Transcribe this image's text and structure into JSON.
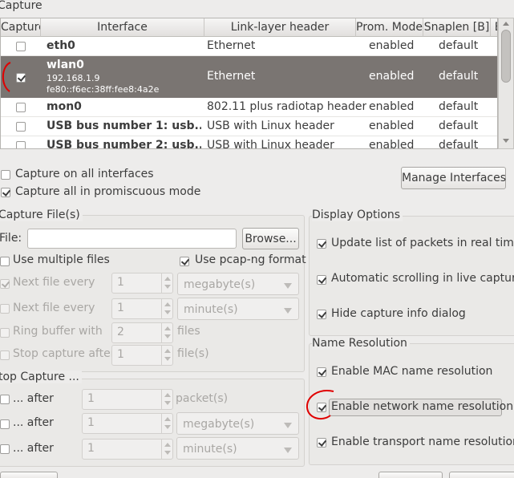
{
  "capture": {
    "legend": "Capture",
    "columns": [
      "Capture",
      "Interface",
      "Link-layer header",
      "Prom. Mode",
      "Snaplen [B]",
      "B"
    ],
    "rows": [
      {
        "checked": false,
        "name": "eth0",
        "addr1": "",
        "addr2": "",
        "link": "Ethernet",
        "prom": "enabled",
        "snap": "default"
      },
      {
        "checked": true,
        "name": "wlan0",
        "addr1": "192.168.1.9",
        "addr2": "fe80::f6ec:38ff:fee8:4a2e",
        "link": "Ethernet",
        "prom": "enabled",
        "snap": "default"
      },
      {
        "checked": false,
        "name": "mon0",
        "addr1": "",
        "addr2": "",
        "link": "802.11 plus radiotap header",
        "prom": "enabled",
        "snap": "default"
      },
      {
        "checked": false,
        "name": "USB bus number 1: usb...",
        "addr1": "",
        "addr2": "",
        "link": "USB with Linux header",
        "prom": "enabled",
        "snap": "default"
      },
      {
        "checked": false,
        "name": "USB bus number 2: usb...",
        "addr1": "",
        "addr2": "",
        "link": "USB with Linux header",
        "prom": "enabled",
        "snap": "default"
      }
    ],
    "all_interfaces": "Capture on all interfaces",
    "all_promiscuous": "Capture all in promiscuous mode",
    "manage_button": "Manage Interfaces"
  },
  "capture_files": {
    "legend": "Capture File(s)",
    "file_label": "File:",
    "file_value": "",
    "browse_button": "Browse...",
    "multiple_files": "Use multiple files",
    "pcapng": "Use pcap-ng format",
    "next_file_size": "Next file every",
    "next_file_size_value": "1",
    "next_file_size_unit": "megabyte(s)",
    "next_file_time": "Next file every",
    "next_file_time_value": "1",
    "next_file_time_unit": "minute(s)",
    "ring_buffer": "Ring buffer with",
    "ring_buffer_value": "2",
    "ring_buffer_unit": "files",
    "stop_after": "Stop capture after",
    "stop_after_value": "1",
    "stop_after_unit": "file(s)"
  },
  "stop_capture": {
    "legend": "top Capture ...",
    "after_label": "... after",
    "packets_value": "1",
    "packets_unit": "packet(s)",
    "size_value": "1",
    "size_unit": "megabyte(s)",
    "time_value": "1",
    "time_unit": "minute(s)"
  },
  "display_options": {
    "legend": "Display Options",
    "update_list": "Update list of packets in real time",
    "auto_scroll": "Automatic scrolling in live capture",
    "hide_info": "Hide capture info dialog"
  },
  "name_resolution": {
    "legend": "Name Resolution",
    "mac": "Enable MAC name resolution",
    "network": "Enable network name resolution",
    "transport": "Enable transport name resolution"
  }
}
